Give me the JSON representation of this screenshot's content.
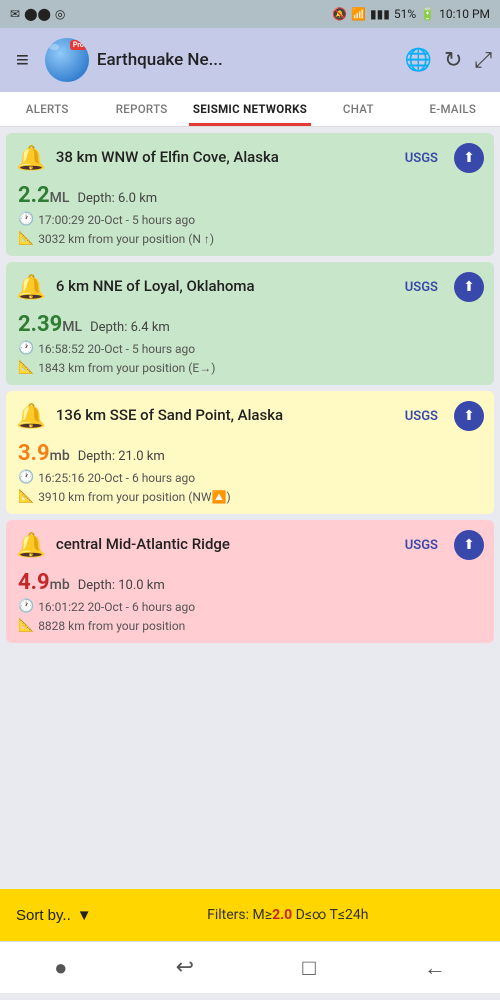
{
  "statusBar": {
    "left": [
      "✉",
      "⬤",
      "%"
    ],
    "battery": "51%",
    "time": "10:10 PM",
    "signal": "📶"
  },
  "header": {
    "title": "Earthquake Ne...",
    "proBadge": "Pro",
    "menuIcon": "≡",
    "globeIcon": "🌐",
    "refreshIcon": "↻",
    "expandIcon": "⤢"
  },
  "tabs": [
    {
      "label": "ALERTS",
      "active": false
    },
    {
      "label": "REPORTS",
      "active": false
    },
    {
      "label": "SEISMIC NETWORKS",
      "active": true
    },
    {
      "label": "CHAT",
      "active": false
    },
    {
      "label": "E-MAILS",
      "active": false
    }
  ],
  "earthquakes": [
    {
      "id": "eq1",
      "color": "green",
      "location": "38 km WNW of Elfin Cove, Alaska",
      "source": "USGS",
      "magnitude": "2.2",
      "magType": "ML",
      "depth": "Depth: 6.0 km",
      "time": "17:00:29 20-Oct - 5 hours ago",
      "distance": "3032 km from your position (N ↑)"
    },
    {
      "id": "eq2",
      "color": "green",
      "location": "6 km NNE of Loyal, Oklahoma",
      "source": "USGS",
      "magnitude": "2.39",
      "magType": "ML",
      "depth": "Depth: 6.4 km",
      "time": "16:58:52 20-Oct - 5 hours ago",
      "distance": "1843 km from your position (E→)"
    },
    {
      "id": "eq3",
      "color": "yellow",
      "location": "136 km SSE of Sand Point, Alaska",
      "source": "USGS",
      "magnitude": "3.9",
      "magType": "mb",
      "depth": "Depth: 21.0 km",
      "time": "16:25:16 20-Oct - 6 hours ago",
      "distance": "3910 km from your position (NW🔼)"
    },
    {
      "id": "eq4",
      "color": "red",
      "location": "central Mid-Atlantic Ridge",
      "source": "USGS",
      "magnitude": "4.9",
      "magType": "mb",
      "depth": "Depth: 10.0 km",
      "time": "16:01:22 20-Oct - 6 hours ago",
      "distance": "8828 km from your position"
    }
  ],
  "bottomBar": {
    "sortLabel": "Sort by..",
    "filterText": "Filters: M≥",
    "filterMag": "2.0",
    "filterDist": " D≤∞ T≤24h"
  },
  "navBar": {
    "icons": [
      "●",
      "↩",
      "□",
      "←"
    ]
  }
}
